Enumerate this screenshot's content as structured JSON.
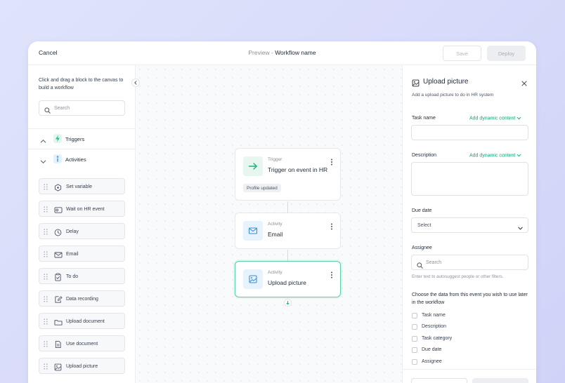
{
  "header": {
    "cancel_label": "Cancel",
    "breadcrumb_prefix": "Preview - ",
    "workflow_name": "Workflow name",
    "save_label": "Save",
    "deploy_label": "Deploy"
  },
  "sidebar": {
    "hint": "Click and drag a block to the canvas to build a workflow",
    "search_placeholder": "Search",
    "groups": [
      {
        "label": "Triggers",
        "icon": "lightning-icon",
        "expanded": false,
        "color": "#22c18a"
      },
      {
        "label": "Activities",
        "icon": "activity-icon",
        "expanded": true,
        "color": "#4aa3e8"
      }
    ],
    "blocks": [
      {
        "label": "Set variable",
        "icon": "variable-icon"
      },
      {
        "label": "Wait on HR event",
        "icon": "wait-icon"
      },
      {
        "label": "Delay",
        "icon": "clock-icon"
      },
      {
        "label": "Email",
        "icon": "mail-icon"
      },
      {
        "label": "To do",
        "icon": "clipboard-icon"
      },
      {
        "label": "Data recording",
        "icon": "edit-icon"
      },
      {
        "label": "Upload document",
        "icon": "folder-icon"
      },
      {
        "label": "Use document",
        "icon": "document-icon"
      },
      {
        "label": "Upload picture",
        "icon": "image-icon"
      }
    ]
  },
  "canvas": {
    "cards": [
      {
        "type": "Trigger",
        "title": "Trigger on event in HR",
        "tag": "Profile updated",
        "icon": "arrow-right-icon"
      },
      {
        "type": "Activity",
        "title": "Email",
        "icon": "mail-icon"
      },
      {
        "type": "Activity",
        "title": "Upload picture",
        "icon": "image-icon",
        "selected": true
      }
    ]
  },
  "panel": {
    "title": "Upload picture",
    "subtitle": "Add a upload picture to do in HR system",
    "task_name_label": "Task name",
    "add_dynamic_label": "Add dynamic content",
    "description_label": "Description",
    "due_date_label": "Due date",
    "due_date_value": "Select",
    "assignee_label": "Assignee",
    "assignee_placeholder": "Search",
    "assignee_helper": "Enter text to autosuggest people or other filters.",
    "choose_text": "Choose the data from this event you wish to use later in the workflow",
    "checkboxes": [
      "Task name",
      "Description",
      "Task category",
      "Due date",
      "Assignee"
    ]
  },
  "colors": {
    "accent": "#16a37b",
    "selected_border": "#5ccfa6",
    "trigger_icon_bg": "#e7f7f0",
    "activity_icon_bg": "#e6f2fc"
  }
}
